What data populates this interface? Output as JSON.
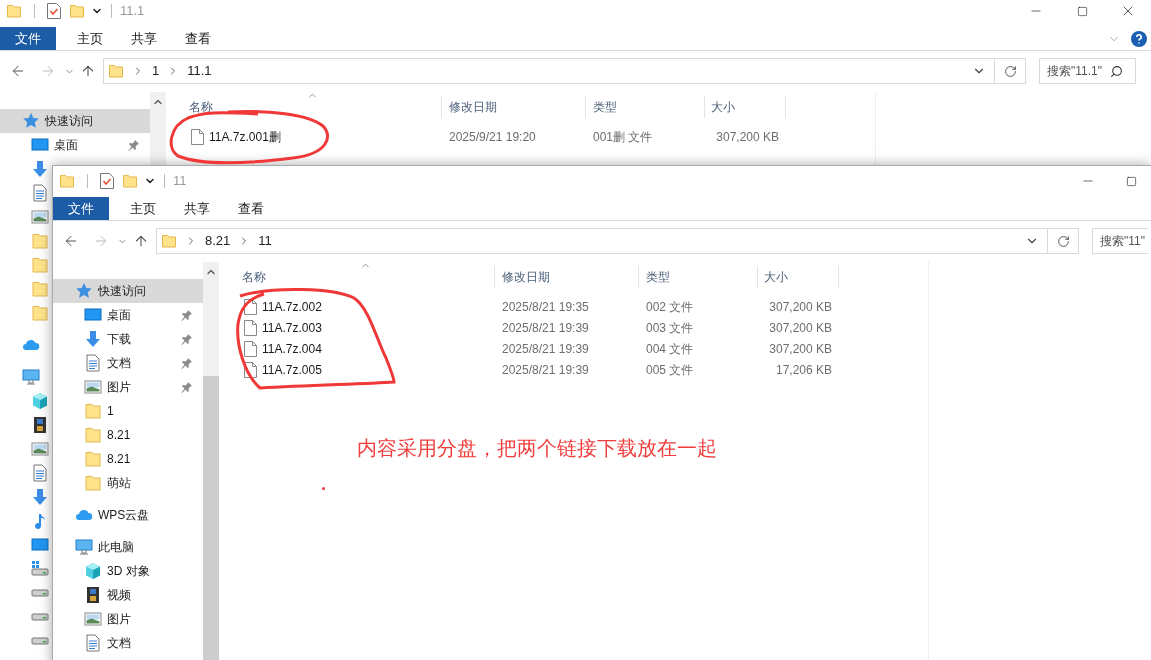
{
  "back_window": {
    "title": "11.1",
    "ribbon_tabs": [
      {
        "label": "文件",
        "kind": "file"
      },
      {
        "label": "主页",
        "kind": "tab"
      },
      {
        "label": "共享",
        "kind": "tab"
      },
      {
        "label": "查看",
        "kind": "tab"
      }
    ],
    "address": {
      "segments": [
        "1",
        "11.1"
      ]
    },
    "search": {
      "placeholder": "搜索\"11.1\""
    },
    "navigation": [
      {
        "kind": "star",
        "label": "快速访问",
        "selected": true,
        "children": [
          {
            "kind": "desktop",
            "label": "桌面",
            "selected": false,
            "pinned": true
          },
          {
            "kind": "download"
          },
          {
            "kind": "document"
          },
          {
            "kind": "picture"
          },
          {
            "kind": "folder"
          },
          {
            "kind": "folder"
          },
          {
            "kind": "folder"
          },
          {
            "kind": "folder"
          }
        ]
      },
      {
        "kind": "cloud"
      },
      {
        "kind": "pc",
        "children": [
          {
            "kind": "cube"
          },
          {
            "kind": "video"
          },
          {
            "kind": "picture"
          },
          {
            "kind": "document"
          },
          {
            "kind": "download"
          },
          {
            "kind": "music"
          },
          {
            "kind": "desktop"
          },
          {
            "kind": "system-drive"
          },
          {
            "kind": "drive"
          },
          {
            "kind": "drive"
          },
          {
            "kind": "drive"
          }
        ]
      }
    ],
    "columns": [
      "名称",
      "修改日期",
      "类型",
      "大小"
    ],
    "files": [
      {
        "name": "11A.7z.001删",
        "modified": "2025/9/21 19:20",
        "type": "001删 文件",
        "size": "307,200 KB"
      }
    ]
  },
  "front_window": {
    "title": "11",
    "ribbon_tabs": [
      {
        "label": "文件",
        "kind": "file"
      },
      {
        "label": "主页",
        "kind": "tab"
      },
      {
        "label": "共享",
        "kind": "tab"
      },
      {
        "label": "查看",
        "kind": "tab"
      }
    ],
    "address": {
      "segments": [
        "8.21",
        "11"
      ]
    },
    "search": {
      "placeholder": "搜索\"11\""
    },
    "navigation": [
      {
        "kind": "star",
        "label": "快速访问",
        "selected": true,
        "pinned": false,
        "children": [
          {
            "kind": "desktop",
            "label": "桌面",
            "selected": false,
            "pinned": true
          },
          {
            "kind": "download",
            "label": "下载",
            "selected": false,
            "pinned": true
          },
          {
            "kind": "document",
            "label": "文档",
            "selected": false,
            "pinned": true
          },
          {
            "kind": "picture",
            "label": "图片",
            "selected": false,
            "pinned": true
          },
          {
            "kind": "folder",
            "label": "1",
            "selected": false,
            "pinned": false
          },
          {
            "kind": "folder",
            "label": "8.21",
            "selected": false,
            "pinned": false
          },
          {
            "kind": "folder",
            "label": "8.21",
            "selected": false,
            "pinned": false
          },
          {
            "kind": "folder",
            "label": "萌站",
            "selected": false,
            "pinned": false
          }
        ]
      },
      {
        "kind": "cloud",
        "label": "WPS云盘",
        "selected": false,
        "pinned": false
      },
      {
        "kind": "pc",
        "label": "此电脑",
        "selected": false,
        "pinned": false,
        "children": [
          {
            "kind": "cube",
            "label": "3D 对象",
            "selected": false,
            "pinned": false
          },
          {
            "kind": "video",
            "label": "视频",
            "selected": false,
            "pinned": false
          },
          {
            "kind": "picture",
            "label": "图片",
            "selected": false,
            "pinned": false
          },
          {
            "kind": "document",
            "label": "文档",
            "selected": false,
            "pinned": false
          }
        ]
      }
    ],
    "columns": [
      "名称",
      "修改日期",
      "类型",
      "大小"
    ],
    "files": [
      {
        "name": "11A.7z.002",
        "modified": "2025/8/21 19:35",
        "type": "002 文件",
        "size": "307,200 KB"
      },
      {
        "name": "11A.7z.003",
        "modified": "2025/8/21 19:39",
        "type": "003 文件",
        "size": "307,200 KB"
      },
      {
        "name": "11A.7z.004",
        "modified": "2025/8/21 19:39",
        "type": "004 文件",
        "size": "307,200 KB"
      },
      {
        "name": "11A.7z.005",
        "modified": "2025/8/21 19:39",
        "type": "005 文件",
        "size": "17,206 KB"
      }
    ],
    "annotation": "内容采用分盘，把两个链接下载放在一起"
  }
}
